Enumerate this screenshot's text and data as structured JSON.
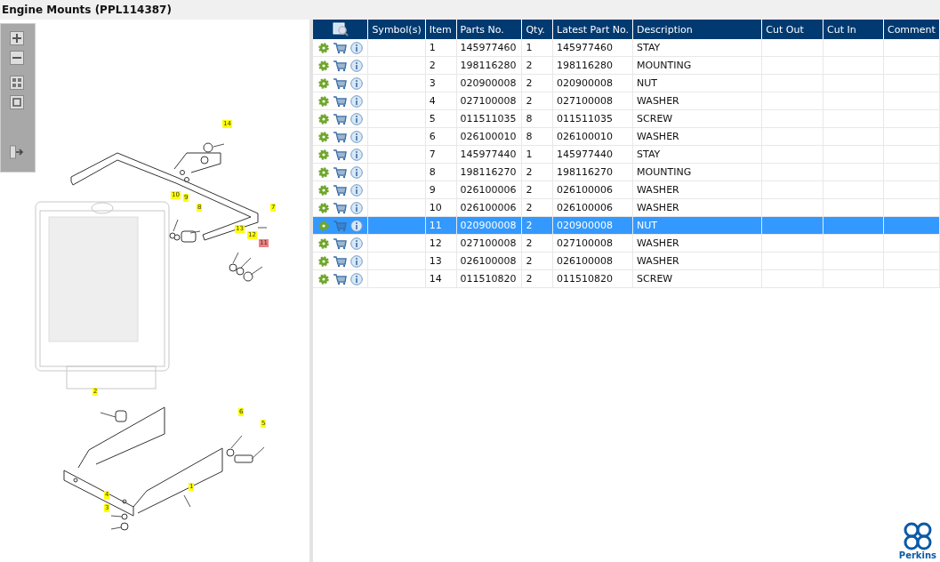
{
  "title": "Engine Mounts (PPL114387)",
  "callouts": [
    {
      "label": "14",
      "selected": false
    },
    {
      "label": "10",
      "selected": false
    },
    {
      "label": "9",
      "selected": false
    },
    {
      "label": "8",
      "selected": false
    },
    {
      "label": "7",
      "selected": false
    },
    {
      "label": "13",
      "selected": false
    },
    {
      "label": "12",
      "selected": false
    },
    {
      "label": "11",
      "selected": true
    },
    {
      "label": "2",
      "selected": false
    },
    {
      "label": "6",
      "selected": false
    },
    {
      "label": "5",
      "selected": false
    },
    {
      "label": "1",
      "selected": false
    },
    {
      "label": "4",
      "selected": false
    },
    {
      "label": "3",
      "selected": false
    }
  ],
  "table": {
    "columns": [
      "Symbol(s)",
      "Item",
      "Parts No.",
      "Qty.",
      "Latest Part No.",
      "Description",
      "Cut Out",
      "Cut In",
      "Comment"
    ],
    "rows": [
      {
        "item": "1",
        "parts_no": "145977460",
        "qty": "1",
        "latest": "145977460",
        "description": "STAY",
        "selected": false
      },
      {
        "item": "2",
        "parts_no": "198116280",
        "qty": "2",
        "latest": "198116280",
        "description": "MOUNTING",
        "selected": false
      },
      {
        "item": "3",
        "parts_no": "020900008",
        "qty": "2",
        "latest": "020900008",
        "description": "NUT",
        "selected": false
      },
      {
        "item": "4",
        "parts_no": "027100008",
        "qty": "2",
        "latest": "027100008",
        "description": "WASHER",
        "selected": false
      },
      {
        "item": "5",
        "parts_no": "011511035",
        "qty": "8",
        "latest": "011511035",
        "description": "SCREW",
        "selected": false
      },
      {
        "item": "6",
        "parts_no": "026100010",
        "qty": "8",
        "latest": "026100010",
        "description": "WASHER",
        "selected": false
      },
      {
        "item": "7",
        "parts_no": "145977440",
        "qty": "1",
        "latest": "145977440",
        "description": "STAY",
        "selected": false
      },
      {
        "item": "8",
        "parts_no": "198116270",
        "qty": "2",
        "latest": "198116270",
        "description": "MOUNTING",
        "selected": false
      },
      {
        "item": "9",
        "parts_no": "026100006",
        "qty": "2",
        "latest": "026100006",
        "description": "WASHER",
        "selected": false
      },
      {
        "item": "10",
        "parts_no": "026100006",
        "qty": "2",
        "latest": "026100006",
        "description": "WASHER",
        "selected": false
      },
      {
        "item": "11",
        "parts_no": "020900008",
        "qty": "2",
        "latest": "020900008",
        "description": "NUT",
        "selected": true
      },
      {
        "item": "12",
        "parts_no": "027100008",
        "qty": "2",
        "latest": "027100008",
        "description": "WASHER",
        "selected": false
      },
      {
        "item": "13",
        "parts_no": "026100008",
        "qty": "2",
        "latest": "026100008",
        "description": "WASHER",
        "selected": false
      },
      {
        "item": "14",
        "parts_no": "011510820",
        "qty": "2",
        "latest": "011510820",
        "description": "SCREW",
        "selected": false
      }
    ]
  },
  "logo": {
    "text": "Perkins"
  }
}
